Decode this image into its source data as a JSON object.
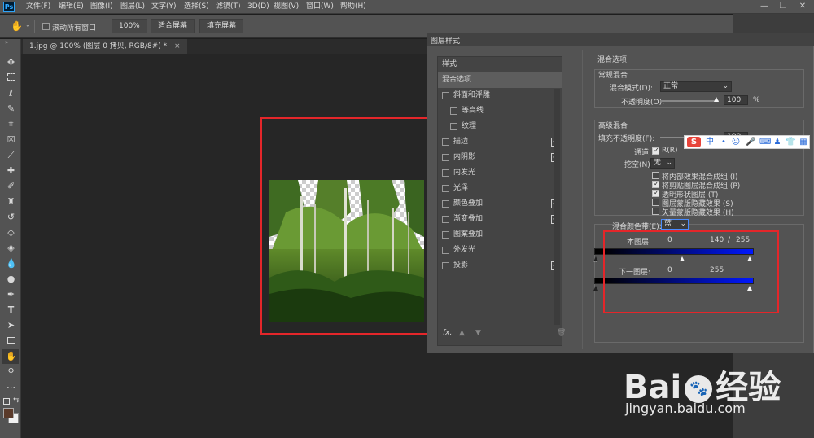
{
  "app": {
    "logo": "Ps"
  },
  "menu": [
    "文件(F)",
    "编辑(E)",
    "图像(I)",
    "图层(L)",
    "文字(Y)",
    "选择(S)",
    "滤镜(T)",
    "3D(D)",
    "视图(V)",
    "窗口(W)",
    "帮助(H)"
  ],
  "window_controls": [
    "—",
    "❐",
    "✕"
  ],
  "options": {
    "scroll_all_label": "滚动所有窗口",
    "zoom_value": "100%",
    "fit_screen": "适合屏幕",
    "fill_screen": "填充屏幕"
  },
  "document": {
    "tab_label": "1.jpg @ 100% (图层 0 拷贝, RGB/8#) *",
    "close": "×"
  },
  "tools": [
    "move-icon",
    "marquee-icon",
    "lasso-icon",
    "quick-select-icon",
    "crop-icon",
    "frame-icon",
    "eyedropper-icon",
    "healing-icon",
    "brush-icon",
    "stamp-icon",
    "history-brush-icon",
    "eraser-icon",
    "paint-bucket-icon",
    "blur-icon",
    "dodge-icon",
    "pen-icon",
    "type-icon",
    "path-select-icon",
    "rectangle-icon",
    "hand-icon",
    "zoom-icon",
    "more-icon"
  ],
  "dialog": {
    "title": "图层样式",
    "styles_header": "样式",
    "blend_options": "混合选项",
    "items": [
      {
        "label": "斜面和浮雕",
        "plus": false,
        "indent": false
      },
      {
        "label": "等高线",
        "plus": false,
        "indent": true
      },
      {
        "label": "纹理",
        "plus": false,
        "indent": true
      },
      {
        "label": "描边",
        "plus": true,
        "indent": false
      },
      {
        "label": "内阴影",
        "plus": true,
        "indent": false
      },
      {
        "label": "内发光",
        "plus": false,
        "indent": false
      },
      {
        "label": "光泽",
        "plus": false,
        "indent": false
      },
      {
        "label": "颜色叠加",
        "plus": true,
        "indent": false
      },
      {
        "label": "渐变叠加",
        "plus": true,
        "indent": false
      },
      {
        "label": "图案叠加",
        "plus": false,
        "indent": false
      },
      {
        "label": "外发光",
        "plus": false,
        "indent": false
      },
      {
        "label": "投影",
        "plus": true,
        "indent": false
      }
    ],
    "footer_fx": "fx.",
    "section_title": "混合选项",
    "general": {
      "title": "常规混合",
      "blend_mode_label": "混合模式(D):",
      "blend_mode_value": "正常",
      "opacity_label": "不透明度(O):",
      "opacity_value": "100",
      "percent": "%"
    },
    "advanced": {
      "title": "高级混合",
      "fill_label": "填充不透明度(F):",
      "fill_value": "100",
      "channels_label": "通道:",
      "channel_r": "R(R)",
      "knockout_label": "挖空(N):",
      "knockout_value": "无",
      "checks": [
        {
          "label": "将内部效果混合成组 (I)",
          "on": false
        },
        {
          "label": "将剪贴图层混合成组 (P)",
          "on": true
        },
        {
          "label": "透明形状图层 (T)",
          "on": true
        },
        {
          "label": "图层蒙版隐藏效果 (S)",
          "on": false
        },
        {
          "label": "矢量蒙版隐藏效果 (H)",
          "on": false
        }
      ]
    },
    "blend_if": {
      "label": "混合颜色带(E):",
      "value": "蓝",
      "this_layer_label": "本图层:",
      "this_left": "0",
      "this_mid": "140",
      "this_slash": "/",
      "this_right": "255",
      "this_mid_fraction": 0.55,
      "under_layer_label": "下一图层:",
      "under_left": "0",
      "under_right": "255"
    }
  },
  "ime": {
    "logo": "S",
    "lang": "中"
  },
  "watermark": {
    "brand": "Bai",
    "brand2": "经验",
    "url": "jingyan.baidu.com"
  }
}
